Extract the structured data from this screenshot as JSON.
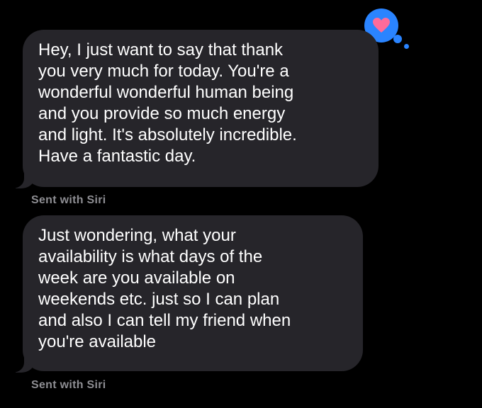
{
  "messages": [
    {
      "lines": [
        "Hey, I just want to say that thank",
        "you very much for today. You're a",
        "wonderful wonderful human being",
        "and you provide so much energy",
        "and light. It's absolutely incredible.",
        "Have a fantastic day."
      ],
      "caption": "Sent with Siri"
    },
    {
      "lines": [
        "Just wondering, what your",
        "availability is what days of the",
        "week are you available on",
        "weekends etc. just so I can plan",
        "and also I can tell my friend when",
        "you're available"
      ],
      "caption": "Sent with Siri"
    }
  ],
  "reaction": {
    "icon": "heart-icon",
    "color": "#ff6b9a",
    "bubble_color": "#2a84ff"
  },
  "colors": {
    "background": "#000000",
    "incoming_bubble": "#26252a",
    "caption": "#8e8e93"
  }
}
